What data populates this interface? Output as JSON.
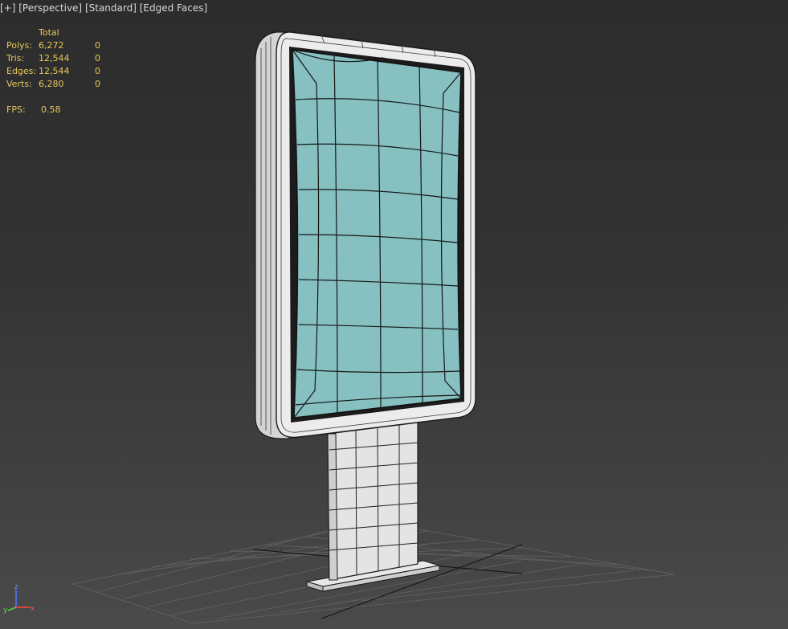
{
  "viewport_menu": {
    "plus": "[+]",
    "view": "[Perspective]",
    "shading": "[Standard]",
    "display": "[Edged Faces]"
  },
  "stats": {
    "header": "Total",
    "rows": [
      {
        "label": "Polys:",
        "total": "6,272",
        "selected": "0"
      },
      {
        "label": "Tris:",
        "total": "12,544",
        "selected": "0"
      },
      {
        "label": "Edges:",
        "total": "12,544",
        "selected": "0"
      },
      {
        "label": "Verts:",
        "total": "6,280",
        "selected": "0"
      }
    ],
    "fps_label": "FPS:",
    "fps_value": "0.58"
  },
  "axis_gizmo": {
    "z": "z",
    "y": "y",
    "x": "x"
  },
  "colors": {
    "stats_text": "#e8c85a",
    "screen": "#86c0c1",
    "frame": "#e6e6e6",
    "wire": "#1a1a1a",
    "grid": "#5a5a5a"
  }
}
